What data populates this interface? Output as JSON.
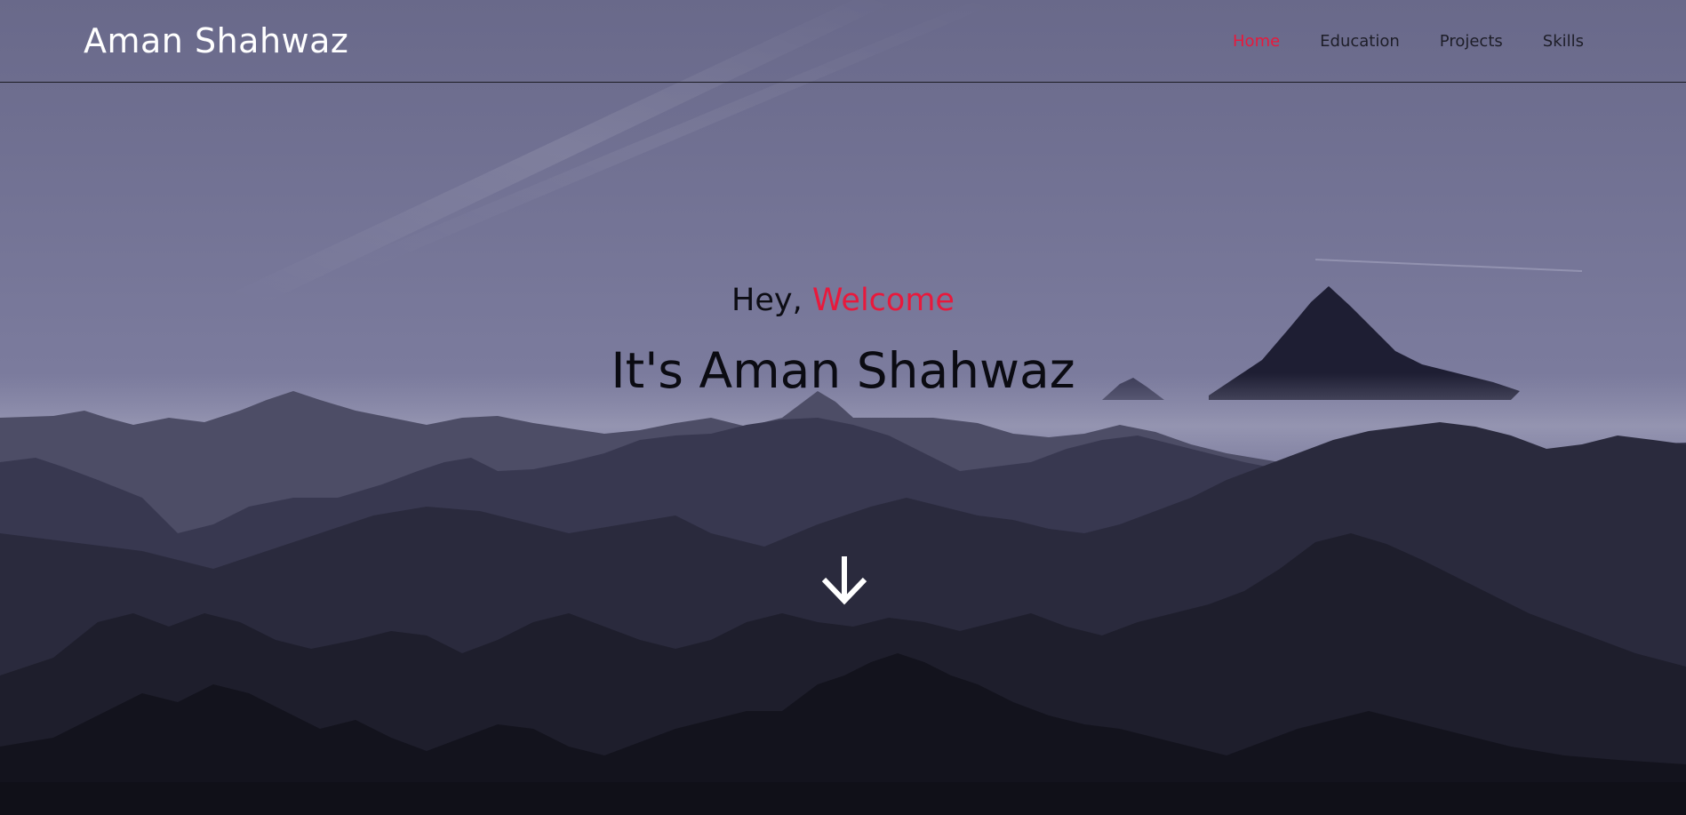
{
  "brand": {
    "name": "Aman Shahwaz"
  },
  "nav": {
    "items": [
      {
        "label": "Home",
        "active": true
      },
      {
        "label": "Education",
        "active": false
      },
      {
        "label": "Projects",
        "active": false
      },
      {
        "label": "Skills",
        "active": false
      }
    ]
  },
  "hero": {
    "greeting_prefix": "Hey,",
    "greeting_accent": "Welcome",
    "headline": "It's Aman Shahwaz",
    "scroll_icon": "arrow-down-icon"
  },
  "colors": {
    "accent": "#e8193c",
    "brand_text": "#ffffff",
    "nav_text": "#1e1e28"
  }
}
